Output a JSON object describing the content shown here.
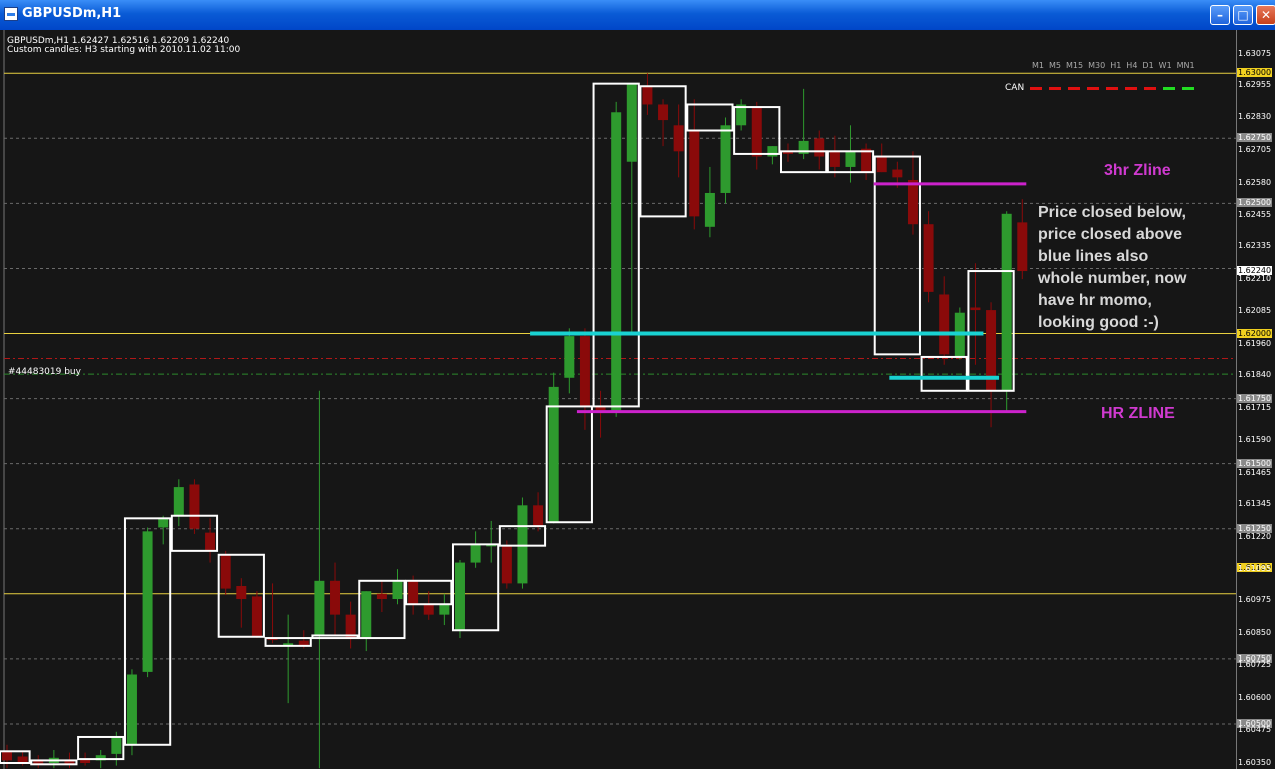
{
  "window": {
    "title": "GBPUSDm,H1",
    "buttons": [
      "minimize",
      "maximize",
      "close"
    ]
  },
  "info": {
    "line1": "GBPUSDm,H1  1.62427 1.62516 1.62209 1.62240",
    "line2": "Custom candles: H3 starting with 2010.11.02 11:00"
  },
  "order_label": "#44483019 buy",
  "indicator": {
    "timeframes": [
      "M1",
      "M5",
      "M15",
      "M30",
      "H1",
      "H4",
      "D1",
      "W1",
      "MN1"
    ],
    "label": "CAN",
    "colors": [
      "#e01010",
      "#e01010",
      "#e01010",
      "#e01010",
      "#e01010",
      "#e01010",
      "#e01010",
      "#22dd22",
      "#22dd22"
    ]
  },
  "annotations": {
    "zline_3hr": "3hr Zline",
    "zline_hr": "HR ZLINE",
    "note_lines": [
      "Price closed below,",
      "price closed above",
      "blue lines also",
      "whole number, now",
      "have hr momo,",
      "looking good :-)"
    ]
  },
  "colors": {
    "background": "#161616",
    "bull": "#2e9a2e",
    "bear": "#8a0a0a",
    "h3_box": "#ffffff",
    "zline": "#cc22cc",
    "blue_line": "#19d2d2",
    "whole_number": "#e8d040",
    "order_line": "#2c8a2c",
    "current_price": "#b01818"
  },
  "chart_data": {
    "type": "candlestick",
    "symbol": "GBPUSDm",
    "timeframe": "H1",
    "ylim": [
      1.6035,
      1.6312
    ],
    "price_ticks": [
      {
        "label": "1.63075",
        "value": 1.63075,
        "style": "plain"
      },
      {
        "label": "1.63000",
        "value": 1.63,
        "style": "gold"
      },
      {
        "label": "1.62955",
        "value": 1.62955,
        "style": "plain"
      },
      {
        "label": "1.62830",
        "value": 1.6283,
        "style": "plain"
      },
      {
        "label": "1.62750",
        "value": 1.6275,
        "style": "grey"
      },
      {
        "label": "1.62705",
        "value": 1.62705,
        "style": "plain"
      },
      {
        "label": "1.62580",
        "value": 1.6258,
        "style": "plain"
      },
      {
        "label": "1.62500",
        "value": 1.625,
        "style": "grey"
      },
      {
        "label": "1.62455",
        "value": 1.62455,
        "style": "plain"
      },
      {
        "label": "1.62335",
        "value": 1.62335,
        "style": "plain"
      },
      {
        "label": "1.62240",
        "value": 1.6224,
        "style": "white"
      },
      {
        "label": "1.62210",
        "value": 1.6221,
        "style": "plain"
      },
      {
        "label": "1.62085",
        "value": 1.62085,
        "style": "plain"
      },
      {
        "label": "1.62000",
        "value": 1.62,
        "style": "gold"
      },
      {
        "label": "1.61960",
        "value": 1.6196,
        "style": "plain"
      },
      {
        "label": "1.61840",
        "value": 1.6184,
        "style": "plain"
      },
      {
        "label": "1.61750",
        "value": 1.6175,
        "style": "grey"
      },
      {
        "label": "1.61715",
        "value": 1.61715,
        "style": "plain"
      },
      {
        "label": "1.61590",
        "value": 1.6159,
        "style": "plain"
      },
      {
        "label": "1.61500",
        "value": 1.615,
        "style": "grey"
      },
      {
        "label": "1.61465",
        "value": 1.61465,
        "style": "plain"
      },
      {
        "label": "1.61345",
        "value": 1.61345,
        "style": "plain"
      },
      {
        "label": "1.61250",
        "value": 1.6125,
        "style": "grey"
      },
      {
        "label": "1.61220",
        "value": 1.6122,
        "style": "plain"
      },
      {
        "label": "1.61100",
        "value": 1.611,
        "style": "gold"
      },
      {
        "label": "1.61095",
        "value": 1.61095,
        "style": "plain"
      },
      {
        "label": "1.60975",
        "value": 1.60975,
        "style": "plain"
      },
      {
        "label": "1.60850",
        "value": 1.6085,
        "style": "plain"
      },
      {
        "label": "1.60750",
        "value": 1.6075,
        "style": "grey"
      },
      {
        "label": "1.60725",
        "value": 1.60725,
        "style": "plain"
      },
      {
        "label": "1.60600",
        "value": 1.606,
        "style": "plain"
      },
      {
        "label": "1.60500",
        "value": 1.605,
        "style": "grey"
      },
      {
        "label": "1.60475",
        "value": 1.60475,
        "style": "plain"
      },
      {
        "label": "1.60350",
        "value": 1.6035,
        "style": "plain"
      }
    ],
    "whole_number_levels": [
      1.63,
      1.62,
      1.61
    ],
    "grid_levels": [
      1.6275,
      1.625,
      1.6225,
      1.6175,
      1.615,
      1.6125,
      1.6075,
      1.605
    ],
    "order_level": 1.61844,
    "current_price": 1.6224,
    "current_price_line": 1.61904,
    "candles": [
      {
        "o": 1.60395,
        "h": 1.6042,
        "l": 1.6033,
        "c": 1.6036
      },
      {
        "o": 1.60375,
        "h": 1.60395,
        "l": 1.6034,
        "c": 1.6035
      },
      {
        "o": 1.6036,
        "h": 1.6038,
        "l": 1.6033,
        "c": 1.60345
      },
      {
        "o": 1.6035,
        "h": 1.604,
        "l": 1.6033,
        "c": 1.6037
      },
      {
        "o": 1.6036,
        "h": 1.6039,
        "l": 1.6033,
        "c": 1.60345
      },
      {
        "o": 1.60365,
        "h": 1.6039,
        "l": 1.6034,
        "c": 1.6035
      },
      {
        "o": 1.6036,
        "h": 1.604,
        "l": 1.6033,
        "c": 1.6038
      },
      {
        "o": 1.60385,
        "h": 1.6047,
        "l": 1.6034,
        "c": 1.6045
      },
      {
        "o": 1.6042,
        "h": 1.6071,
        "l": 1.6038,
        "c": 1.6069
      },
      {
        "o": 1.607,
        "h": 1.61255,
        "l": 1.6068,
        "c": 1.6124
      },
      {
        "o": 1.61255,
        "h": 1.613,
        "l": 1.6119,
        "c": 1.6129
      },
      {
        "o": 1.613,
        "h": 1.6144,
        "l": 1.6126,
        "c": 1.6141
      },
      {
        "o": 1.6142,
        "h": 1.6144,
        "l": 1.6123,
        "c": 1.6125
      },
      {
        "o": 1.61235,
        "h": 1.6129,
        "l": 1.6112,
        "c": 1.61165
      },
      {
        "o": 1.6115,
        "h": 1.61165,
        "l": 1.60995,
        "c": 1.6102
      },
      {
        "o": 1.6103,
        "h": 1.6106,
        "l": 1.6087,
        "c": 1.6098
      },
      {
        "o": 1.6099,
        "h": 1.6101,
        "l": 1.6083,
        "c": 1.60835
      },
      {
        "o": 1.6083,
        "h": 1.6104,
        "l": 1.6081,
        "c": 1.60825
      },
      {
        "o": 1.6081,
        "h": 1.6092,
        "l": 1.6058,
        "c": 1.6081
      },
      {
        "o": 1.6082,
        "h": 1.6086,
        "l": 1.6079,
        "c": 1.608
      },
      {
        "o": 1.6084,
        "h": 1.6178,
        "l": 1.6033,
        "c": 1.6105
      },
      {
        "o": 1.6105,
        "h": 1.6112,
        "l": 1.6084,
        "c": 1.6092
      },
      {
        "o": 1.6092,
        "h": 1.6097,
        "l": 1.6079,
        "c": 1.6083
      },
      {
        "o": 1.6083,
        "h": 1.6101,
        "l": 1.6078,
        "c": 1.6101
      },
      {
        "o": 1.61,
        "h": 1.6105,
        "l": 1.6093,
        "c": 1.6098
      },
      {
        "o": 1.6098,
        "h": 1.61095,
        "l": 1.6096,
        "c": 1.6105
      },
      {
        "o": 1.6105,
        "h": 1.6107,
        "l": 1.6092,
        "c": 1.6096
      },
      {
        "o": 1.6096,
        "h": 1.6101,
        "l": 1.609,
        "c": 1.6092
      },
      {
        "o": 1.6092,
        "h": 1.61,
        "l": 1.6088,
        "c": 1.6096
      },
      {
        "o": 1.6086,
        "h": 1.6113,
        "l": 1.6083,
        "c": 1.6112
      },
      {
        "o": 1.6112,
        "h": 1.6124,
        "l": 1.611,
        "c": 1.6119
      },
      {
        "o": 1.6119,
        "h": 1.6128,
        "l": 1.6112,
        "c": 1.6119
      },
      {
        "o": 1.61185,
        "h": 1.61205,
        "l": 1.6102,
        "c": 1.6104
      },
      {
        "o": 1.6104,
        "h": 1.6137,
        "l": 1.6102,
        "c": 1.6134
      },
      {
        "o": 1.6134,
        "h": 1.6139,
        "l": 1.6124,
        "c": 1.6126
      },
      {
        "o": 1.61275,
        "h": 1.6185,
        "l": 1.6127,
        "c": 1.61795
      },
      {
        "o": 1.6183,
        "h": 1.6202,
        "l": 1.6177,
        "c": 1.6199
      },
      {
        "o": 1.6199,
        "h": 1.6202,
        "l": 1.6163,
        "c": 1.6172
      },
      {
        "o": 1.6172,
        "h": 1.6178,
        "l": 1.616,
        "c": 1.61705
      },
      {
        "o": 1.61705,
        "h": 1.6289,
        "l": 1.6168,
        "c": 1.6285
      },
      {
        "o": 1.6266,
        "h": 1.6296,
        "l": 1.62,
        "c": 1.6296
      },
      {
        "o": 1.6295,
        "h": 1.63,
        "l": 1.6284,
        "c": 1.6288
      },
      {
        "o": 1.6288,
        "h": 1.629,
        "l": 1.6272,
        "c": 1.6282
      },
      {
        "o": 1.628,
        "h": 1.6288,
        "l": 1.626,
        "c": 1.627
      },
      {
        "o": 1.6278,
        "h": 1.629,
        "l": 1.624,
        "c": 1.6245
      },
      {
        "o": 1.6241,
        "h": 1.6264,
        "l": 1.6237,
        "c": 1.6254
      },
      {
        "o": 1.6254,
        "h": 1.6283,
        "l": 1.625,
        "c": 1.628
      },
      {
        "o": 1.628,
        "h": 1.629,
        "l": 1.6278,
        "c": 1.6288
      },
      {
        "o": 1.6287,
        "h": 1.6289,
        "l": 1.6263,
        "c": 1.6268
      },
      {
        "o": 1.6268,
        "h": 1.6272,
        "l": 1.6265,
        "c": 1.6272
      },
      {
        "o": 1.627,
        "h": 1.6273,
        "l": 1.6266,
        "c": 1.6269
      },
      {
        "o": 1.6269,
        "h": 1.6294,
        "l": 1.6267,
        "c": 1.6274
      },
      {
        "o": 1.6275,
        "h": 1.6278,
        "l": 1.6263,
        "c": 1.6268
      },
      {
        "o": 1.627,
        "h": 1.6276,
        "l": 1.626,
        "c": 1.6264
      },
      {
        "o": 1.6264,
        "h": 1.628,
        "l": 1.6258,
        "c": 1.627
      },
      {
        "o": 1.6271,
        "h": 1.6273,
        "l": 1.6259,
        "c": 1.6262
      },
      {
        "o": 1.6268,
        "h": 1.6273,
        "l": 1.6262,
        "c": 1.6262
      },
      {
        "o": 1.6263,
        "h": 1.6266,
        "l": 1.6256,
        "c": 1.626
      },
      {
        "o": 1.6259,
        "h": 1.627,
        "l": 1.6238,
        "c": 1.6242
      },
      {
        "o": 1.6242,
        "h": 1.6247,
        "l": 1.6212,
        "c": 1.6216
      },
      {
        "o": 1.6215,
        "h": 1.6222,
        "l": 1.6188,
        "c": 1.6192
      },
      {
        "o": 1.6191,
        "h": 1.621,
        "l": 1.619,
        "c": 1.6208
      },
      {
        "o": 1.621,
        "h": 1.6227,
        "l": 1.6188,
        "c": 1.6209
      },
      {
        "o": 1.6209,
        "h": 1.6212,
        "l": 1.6164,
        "c": 1.6178
      },
      {
        "o": 1.6178,
        "h": 1.6247,
        "l": 1.617,
        "c": 1.6246
      },
      {
        "o": 1.62427,
        "h": 1.62516,
        "l": 1.62209,
        "c": 1.6224
      }
    ],
    "h3_boxes": [
      {
        "from": 0,
        "to": 1,
        "o": 1.60395,
        "c": 1.6035
      },
      {
        "from": 2,
        "to": 4,
        "o": 1.6036,
        "c": 1.60345
      },
      {
        "from": 5,
        "to": 7,
        "o": 1.60365,
        "c": 1.6045
      },
      {
        "from": 8,
        "to": 10,
        "o": 1.6042,
        "c": 1.6129
      },
      {
        "from": 11,
        "to": 13,
        "o": 1.613,
        "c": 1.61165
      },
      {
        "from": 14,
        "to": 16,
        "o": 1.6115,
        "c": 1.60835
      },
      {
        "from": 17,
        "to": 19,
        "o": 1.6083,
        "c": 1.608
      },
      {
        "from": 20,
        "to": 22,
        "o": 1.6084,
        "c": 1.6083
      },
      {
        "from": 23,
        "to": 25,
        "o": 1.6083,
        "c": 1.6105
      },
      {
        "from": 26,
        "to": 28,
        "o": 1.6105,
        "c": 1.6096
      },
      {
        "from": 29,
        "to": 31,
        "o": 1.6086,
        "c": 1.6119
      },
      {
        "from": 32,
        "to": 34,
        "o": 1.61185,
        "c": 1.6126
      },
      {
        "from": 35,
        "to": 37,
        "o": 1.61275,
        "c": 1.6172
      },
      {
        "from": 38,
        "to": 40,
        "o": 1.6172,
        "c": 1.6296
      },
      {
        "from": 41,
        "to": 43,
        "o": 1.6295,
        "c": 1.6245
      },
      {
        "from": 44,
        "to": 46,
        "o": 1.6278,
        "c": 1.6288
      },
      {
        "from": 47,
        "to": 49,
        "o": 1.6287,
        "c": 1.6269
      },
      {
        "from": 50,
        "to": 52,
        "o": 1.627,
        "c": 1.6262
      },
      {
        "from": 53,
        "to": 55,
        "o": 1.627,
        "c": 1.6262
      },
      {
        "from": 56,
        "to": 58,
        "o": 1.6268,
        "c": 1.6192
      },
      {
        "from": 59,
        "to": 61,
        "o": 1.6191,
        "c": 1.6178
      },
      {
        "from": 62,
        "to": 64,
        "o": 1.6178,
        "c": 1.6224
      }
    ],
    "zlines": [
      {
        "name": "3hr Zline",
        "level": 1.62575,
        "from": 56,
        "to": 65
      },
      {
        "name": "HR ZLINE",
        "level": 1.617,
        "from": 37,
        "to": 65
      }
    ],
    "blue_lines": [
      {
        "level": 1.62,
        "from": 34,
        "to": 62
      },
      {
        "level": 1.6183,
        "from": 57,
        "to": 63
      }
    ]
  }
}
